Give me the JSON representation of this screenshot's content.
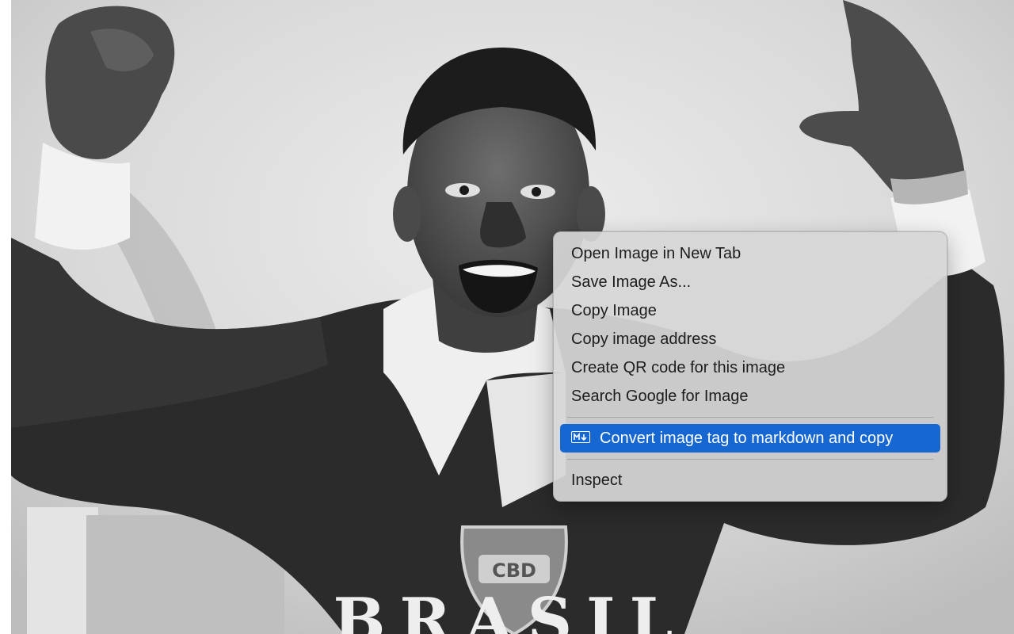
{
  "context_menu": {
    "items": [
      {
        "label": "Open Image in New Tab"
      },
      {
        "label": "Save Image As..."
      },
      {
        "label": "Copy Image"
      },
      {
        "label": "Copy image address"
      },
      {
        "label": "Create QR code for this image"
      },
      {
        "label": "Search Google for Image"
      }
    ],
    "extension_item": {
      "label": "Convert image tag to markdown and copy",
      "icon": "markdown-icon",
      "highlighted": true
    },
    "inspect_label": "Inspect",
    "highlight_color": "#1667d1"
  },
  "photo": {
    "crest_text": "CBD",
    "shirt_text": "BRASIL",
    "style": "black-and-white"
  }
}
